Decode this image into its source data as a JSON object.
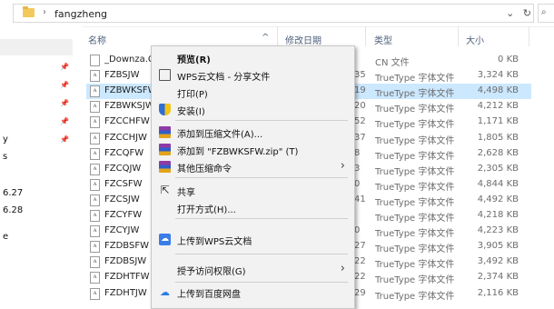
{
  "address": {
    "crumb_sep": "›",
    "path": "fangzheng",
    "dropdown": "⌄",
    "refresh": "↻",
    "search_stub": "⌕"
  },
  "columns": {
    "name": "名称",
    "date": "修改日期",
    "type": "类型",
    "size": "大小"
  },
  "left_pane": {
    "labels": [
      "y",
      "s",
      "6.27",
      "6.28",
      "e"
    ]
  },
  "files": [
    {
      "name": "_Downza.Com",
      "date": "",
      "type": "CN 文件",
      "size": "0 KB",
      "icon": "generic-file",
      "selected": false
    },
    {
      "name": "FZBSJW",
      "date": "35",
      "type": "TrueType 字体文件",
      "size": "3,324 KB",
      "icon": "font-file",
      "selected": false
    },
    {
      "name": "FZBWKSFW",
      "date": "19",
      "type": "TrueType 字体文件",
      "size": "4,498 KB",
      "icon": "font-file",
      "selected": true
    },
    {
      "name": "FZBWKSJW",
      "date": "20",
      "type": "TrueType 字体文件",
      "size": "4,212 KB",
      "icon": "font-file",
      "selected": false
    },
    {
      "name": "FZCCHFW",
      "date": "52",
      "type": "TrueType 字体文件",
      "size": "1,171 KB",
      "icon": "font-file",
      "selected": false
    },
    {
      "name": "FZCCHJW",
      "date": "37",
      "type": "TrueType 字体文件",
      "size": "1,805 KB",
      "icon": "font-file",
      "selected": false
    },
    {
      "name": "FZCQFW",
      "date": "8",
      "type": "TrueType 字体文件",
      "size": "2,628 KB",
      "icon": "font-file",
      "selected": false
    },
    {
      "name": "FZCQJW",
      "date": "3",
      "type": "TrueType 字体文件",
      "size": "2,305 KB",
      "icon": "font-file",
      "selected": false
    },
    {
      "name": "FZCSFW",
      "date": "0",
      "type": "TrueType 字体文件",
      "size": "4,844 KB",
      "icon": "font-file",
      "selected": false
    },
    {
      "name": "FZCSJW",
      "date": "41",
      "type": "TrueType 字体文件",
      "size": "4,492 KB",
      "icon": "font-file",
      "selected": false
    },
    {
      "name": "FZCYFW",
      "date": "",
      "type": "TrueType 字体文件",
      "size": "4,218 KB",
      "icon": "font-file",
      "selected": false
    },
    {
      "name": "FZCYJW",
      "date": "0",
      "type": "TrueType 字体文件",
      "size": "4,223 KB",
      "icon": "font-file",
      "selected": false
    },
    {
      "name": "FZDBSFW",
      "date": "27",
      "type": "TrueType 字体文件",
      "size": "3,905 KB",
      "icon": "font-file",
      "selected": false
    },
    {
      "name": "FZDBSJW",
      "date": "22",
      "type": "TrueType 字体文件",
      "size": "3,492 KB",
      "icon": "font-file",
      "selected": false
    },
    {
      "name": "FZDHTFW",
      "date": "22",
      "type": "TrueType 字体文件",
      "size": "2,374 KB",
      "icon": "font-file",
      "selected": false
    },
    {
      "name": "FZDHTJW",
      "date": "29",
      "type": "TrueType 字体文件",
      "size": "2,116 KB",
      "icon": "font-file",
      "selected": false
    }
  ],
  "context_menu": {
    "items": [
      {
        "label": "预览(R)",
        "bold": true,
        "icon": "",
        "submenu": false
      },
      {
        "label": "WPS云文档 - 分享文件",
        "bold": false,
        "icon": "share-doc-icon",
        "submenu": false
      },
      {
        "label": "打印(P)",
        "bold": false,
        "icon": "",
        "submenu": false
      },
      {
        "label": "安装(I)",
        "bold": false,
        "icon": "uac-shield-icon",
        "submenu": false
      },
      {
        "label": "添加到压缩文件(A)...",
        "bold": false,
        "icon": "winrar-icon",
        "submenu": false
      },
      {
        "label": "添加到 \"FZBWKSFW.zip\" (T)",
        "bold": false,
        "icon": "winrar-icon",
        "submenu": false
      },
      {
        "label": "其他压缩命令",
        "bold": false,
        "icon": "winrar-icon",
        "submenu": true
      },
      {
        "label": "共享",
        "bold": false,
        "icon": "share-icon",
        "submenu": false
      },
      {
        "label": "打开方式(H)...",
        "bold": false,
        "icon": "",
        "submenu": false
      },
      {
        "label": "上传到WPS云文档",
        "bold": false,
        "icon": "wps-cloud-icon",
        "submenu": false
      },
      {
        "label": "授予访问权限(G)",
        "bold": false,
        "icon": "",
        "submenu": true
      },
      {
        "label": "上传到百度网盘",
        "bold": false,
        "icon": "baidu-netdisk-icon",
        "submenu": false
      }
    ]
  },
  "colors": {
    "selection": "#cce8ff",
    "menu_bg": "#f2f2f2",
    "header_text": "#4c607a"
  }
}
